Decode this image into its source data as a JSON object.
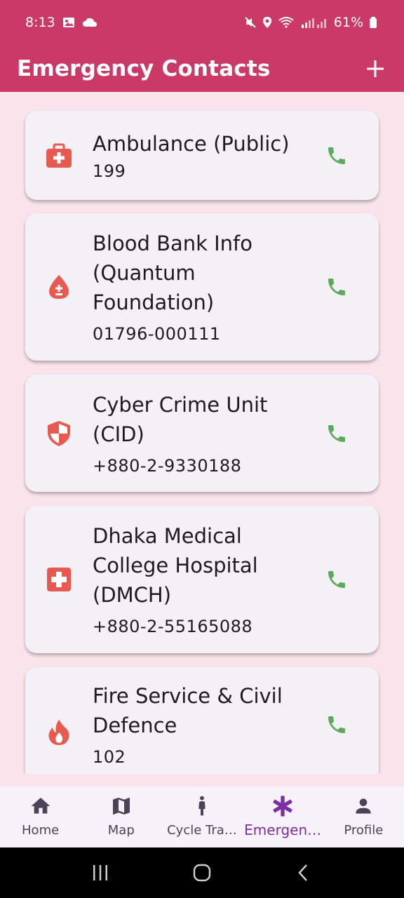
{
  "status_bar": {
    "time": "8:13",
    "battery": "61%"
  },
  "app_bar": {
    "title": "Emergency Contacts"
  },
  "contacts": [
    {
      "name": "Ambulance (Public)",
      "phone": "199",
      "icon": "medical-kit-icon"
    },
    {
      "name": "Blood Bank Info (Quantum Foundation)",
      "phone": "01796-000111",
      "icon": "blood-drop-icon"
    },
    {
      "name": "Cyber Crime Unit (CID)",
      "phone": "+880-2-9330188",
      "icon": "shield-icon"
    },
    {
      "name": "Dhaka Medical College Hospital (DMCH)",
      "phone": "+880-2-55165088",
      "icon": "hospital-cross-icon"
    },
    {
      "name": "Fire Service & Civil Defence",
      "phone": "102",
      "icon": "fire-icon"
    }
  ],
  "colors": {
    "accent": "#cb3a66",
    "icon_red": "#e85a4f",
    "call_green": "#5cab5c",
    "active_nav": "#7b2fa3"
  },
  "bottom_nav": {
    "items": [
      {
        "label": "Home",
        "icon": "home-icon"
      },
      {
        "label": "Map",
        "icon": "map-icon"
      },
      {
        "label": "Cycle Tra…",
        "icon": "cycle-tracker-icon"
      },
      {
        "label": "Emergen…",
        "icon": "emergency-icon",
        "active": true
      },
      {
        "label": "Profile",
        "icon": "profile-icon"
      }
    ]
  }
}
